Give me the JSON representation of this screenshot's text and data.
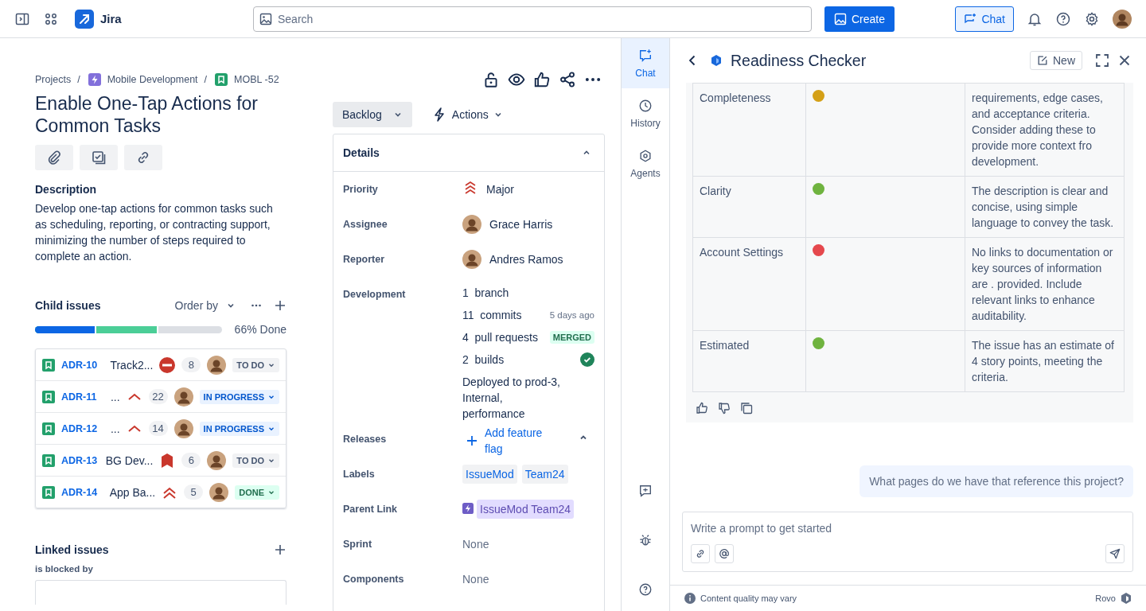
{
  "topbar": {
    "product": "Jira",
    "search": {
      "placeholder": "Search"
    },
    "create": "Create",
    "chat": {
      "label": "Chat",
      "selected": true
    }
  },
  "breadcrumbs": [
    {
      "label": "Projects",
      "kind": "plain",
      "separator": "/"
    },
    {
      "label": "Mobile Development",
      "kind": "project",
      "separator": "/"
    },
    {
      "label": "MOBL -52",
      "kind": "story"
    }
  ],
  "issue": {
    "title": "Enable One-Tap Actions for Common Tasks",
    "description_heading": "Description",
    "description": "Develop one-tap actions for common tasks such as scheduling, reporting, or contracting support, minimizing the number of steps required to complete an action."
  },
  "child_issues": {
    "heading": "Child issues",
    "order_by": "Order by",
    "progress_label": "66% Done",
    "segments": [
      {
        "color": "#0c66e4",
        "level": 0.33
      },
      {
        "color": "#4bce97",
        "level": 0.66
      }
    ],
    "rows": [
      {
        "key": "ADR-10",
        "summary": "Track2...",
        "priority": {
          "kind": "blocker"
        },
        "count": "8",
        "status": {
          "label": "TO DO",
          "kind": "todo"
        }
      },
      {
        "key": "ADR-11",
        "summary": "...",
        "priority": {
          "kind": "high"
        },
        "count": "22",
        "status": {
          "label": "IN PROGRESS",
          "kind": "inprogress"
        }
      },
      {
        "key": "ADR-12",
        "summary": "...",
        "priority": {
          "kind": "high"
        },
        "count": "14",
        "status": {
          "label": "IN PROGRESS",
          "kind": "inprogress"
        }
      },
      {
        "key": "ADR-13",
        "summary": "BG Dev...",
        "priority": {
          "kind": "critical"
        },
        "count": "6",
        "status": {
          "label": "TO DO",
          "kind": "todo"
        }
      },
      {
        "key": "ADR-14",
        "summary": "App Ba...",
        "priority": {
          "kind": "major"
        },
        "count": "5",
        "status": {
          "label": "DONE",
          "kind": "done"
        }
      }
    ]
  },
  "linked_issues": {
    "heading": "Linked issues",
    "relation": "is blocked by"
  },
  "status_button": "Backlog",
  "actions_button": "Actions",
  "details": {
    "heading": "Details",
    "expanded": true,
    "fields": [
      {
        "kind": "priority",
        "label": "Priority",
        "value": "Major",
        "priority": {
          "kind": "major"
        }
      },
      {
        "kind": "user",
        "label": "Assignee",
        "value": "Grace Harris"
      },
      {
        "kind": "user",
        "label": "Reporter",
        "value": "Andres Ramos"
      },
      {
        "kind": "development",
        "label": "Development",
        "items": [
          {
            "count": "1",
            "label": "branch"
          },
          {
            "count": "11",
            "label": "commits",
            "meta": {
              "kind": "time",
              "text": "5 days ago"
            }
          },
          {
            "count": "4",
            "label": "pull requests",
            "meta": {
              "kind": "lozenge",
              "text": "MERGED"
            }
          },
          {
            "count": "2",
            "label": "builds",
            "meta": {
              "kind": "success"
            }
          }
        ],
        "deployed": "Deployed to prod-3, Internal, performance"
      },
      {
        "kind": "action",
        "label": "Releases",
        "value": "Add feature flag",
        "expanded": true
      },
      {
        "kind": "labels",
        "label": "Labels",
        "values": [
          "IssueMod",
          "Team24"
        ]
      },
      {
        "kind": "parent",
        "label": "Parent Link",
        "value": "IssueMod Team24"
      },
      {
        "kind": "text",
        "label": "Sprint",
        "value": "None"
      },
      {
        "kind": "text",
        "label": "Components",
        "value": "None"
      }
    ]
  },
  "rail": {
    "items": [
      {
        "label": "Chat",
        "selected": true
      },
      {
        "label": "History",
        "selected": false
      },
      {
        "label": "Agents",
        "selected": false
      }
    ]
  },
  "chat": {
    "title": "Readiness Checker",
    "new_button": "New",
    "rows": [
      {
        "criterion": "Completeness",
        "color": "#d4a017",
        "text": "requirements, edge cases, and acceptance criteria. Consider adding these to provide more context fro development."
      },
      {
        "criterion": "Clarity",
        "color": "#6fb33f",
        "text": "The description is clear and concise, using simple language to convey the task."
      },
      {
        "criterion": "Account Settings",
        "color": "#e5484d",
        "text": "No links to documentation or key sources of information are . provided. Include relevant links to enhance auditability."
      },
      {
        "criterion": "Estimated",
        "color": "#6fb33f",
        "text": "The issue has an estimate of 4 story points, meeting the criteria."
      }
    ],
    "user_message": "What pages do we have that reference this project?",
    "prompt": {
      "placeholder": "Write a prompt to get started"
    },
    "footer": {
      "note": "Content quality may vary",
      "brand": "Rovo"
    }
  }
}
